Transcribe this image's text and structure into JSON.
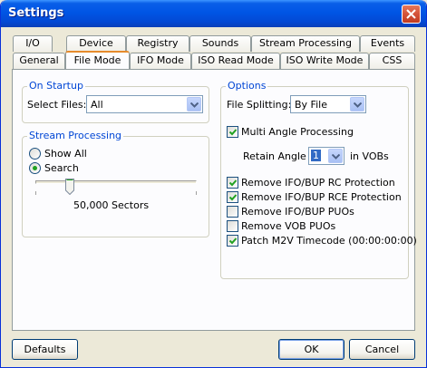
{
  "window": {
    "title": "Settings"
  },
  "tabs": {
    "row1": [
      "I/O",
      "Device",
      "Registry",
      "Sounds",
      "Stream Processing",
      "Events"
    ],
    "row2": [
      "General",
      "File Mode",
      "IFO Mode",
      "ISO Read Mode",
      "ISO Write Mode",
      "CSS"
    ],
    "active": "File Mode"
  },
  "on_startup": {
    "label": "On Startup",
    "select_files_label": "Select Files:",
    "select_files_value": "All"
  },
  "stream_processing": {
    "label": "Stream Processing",
    "show_all_label": "Show All",
    "search_label": "Search",
    "selected": "Search",
    "slider_value": 50000,
    "slider_label": "50,000 Sectors"
  },
  "options": {
    "label": "Options",
    "file_splitting_label": "File Splitting:",
    "file_splitting_value": "By File",
    "multi_angle_label": "Multi Angle Processing",
    "multi_angle_checked": true,
    "retain_angle_label": "Retain Angle",
    "retain_angle_value": "1",
    "in_vobs_label": "in VOBs",
    "checkboxes": [
      {
        "label": "Remove IFO/BUP RC Protection",
        "checked": true
      },
      {
        "label": "Remove IFO/BUP RCE Protection",
        "checked": true
      },
      {
        "label": "Remove IFO/BUP PUOs",
        "checked": false
      },
      {
        "label": "Remove VOB PUOs",
        "checked": false
      },
      {
        "label": "Patch M2V Timecode (00:00:00:00)",
        "checked": true
      }
    ]
  },
  "buttons": {
    "defaults": "Defaults",
    "ok": "OK",
    "cancel": "Cancel"
  },
  "colors": {
    "accent": "#0046d5",
    "tab_highlight": "#e68b2c",
    "title_bar": "#0055e5",
    "check": "#21a121"
  }
}
